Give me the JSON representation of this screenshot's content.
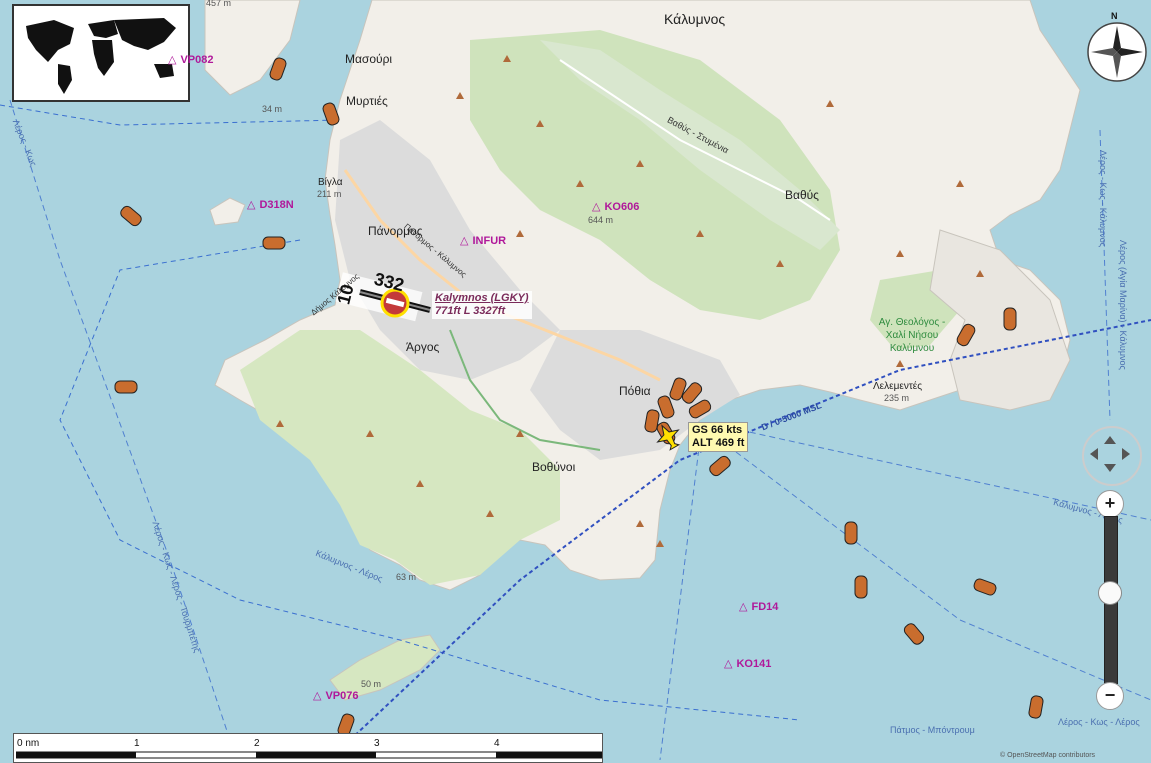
{
  "map": {
    "places": [
      {
        "id": "kalymnos-town",
        "text": "Κάλυμνος"
      },
      {
        "id": "masouri",
        "text": "Μασούρι"
      },
      {
        "id": "myrties",
        "text": "Μυρτιές"
      },
      {
        "id": "vigla",
        "text": "Βίγλα"
      },
      {
        "id": "panormos",
        "text": "Πάνορμος"
      },
      {
        "id": "argos",
        "text": "Άργος"
      },
      {
        "id": "pothia",
        "text": "Πόθια"
      },
      {
        "id": "vothynoi",
        "text": "Βοθύνοι"
      },
      {
        "id": "vathys",
        "text": "Βαθύς"
      },
      {
        "id": "telementes",
        "text": "Λελεμεντές"
      },
      {
        "id": "ag-theologos",
        "text": "Αγ. Θεολόγος - Χαλί Νήσου Καλύμνου"
      }
    ],
    "elevations": [
      {
        "id": "e457",
        "text": "457 m"
      },
      {
        "id": "e34",
        "text": "34 m"
      },
      {
        "id": "e211",
        "text": "211 m"
      },
      {
        "id": "e644",
        "text": "644 m"
      },
      {
        "id": "e235",
        "text": "235 m"
      },
      {
        "id": "e63",
        "text": "63 m"
      },
      {
        "id": "e50",
        "text": "50 m"
      }
    ],
    "roads": [
      {
        "id": "road-vathys",
        "text": "Βαθύς - Στυμένια"
      },
      {
        "id": "road-panormos",
        "text": "Πανόρμος - Κάλυμνος"
      },
      {
        "id": "road-dimos",
        "text": "Δήμος Κάλυμνος"
      }
    ],
    "sea_routes": [
      {
        "id": "sr1",
        "text": "Λέρος - Κως - Λέρος - Τουρμπέτης"
      },
      {
        "id": "sr2",
        "text": "Κάλυμνος - Λέρος"
      },
      {
        "id": "sr3",
        "text": "Πάτμος - Μπόντρουμ"
      },
      {
        "id": "sr4",
        "text": "Λέρος - Κως - Λέρος"
      },
      {
        "id": "sr5",
        "text": "Λέρος (Αγία Μαρίνα) - Κάλυμνος"
      },
      {
        "id": "sr6",
        "text": "Κάλυμνος - Λέρος"
      },
      {
        "id": "sr7",
        "text": "Λέρος - Κως"
      },
      {
        "id": "sr8",
        "text": "Λέρος - Κως - Κάλυμνος"
      }
    ],
    "waypoints": [
      "VP082",
      "D318N",
      "INFUR",
      "KO606",
      "FD14",
      "KO141",
      "VP076"
    ],
    "airport": {
      "name": "Kalymnos (LGKY)",
      "info": "771ft L 3327ft",
      "rwy_a": "332",
      "rwy_b": "10"
    },
    "aircraft": {
      "gs": "GS 66 kts",
      "alt": "ALT 469 ft"
    },
    "airspace_label": "D / 0-5000 MSL",
    "compass_north": "N",
    "scale": {
      "labels": [
        "0 nm",
        "1",
        "2",
        "3",
        "4"
      ]
    },
    "zoom": {
      "in": "+",
      "out": "−",
      "level": 0.55
    },
    "copyright": "© OpenStreetMap contributors",
    "colors": {
      "sea": "#aad3df",
      "land": "#f2efe9",
      "forest": "#add19e",
      "green": "#c8e1b5",
      "urban": "#dddddd",
      "waypoint": "#b0189a",
      "boat": "#c96d2e"
    }
  }
}
